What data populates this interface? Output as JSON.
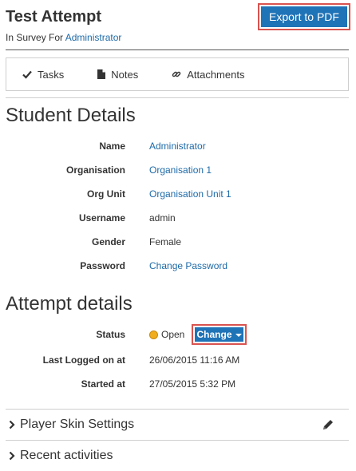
{
  "header": {
    "title": "Test Attempt",
    "subtitle_prefix": "In Survey For",
    "subtitle_link": "Administrator",
    "export_label": "Export to PDF"
  },
  "tabs": [
    {
      "label": "Tasks",
      "icon": "check-icon"
    },
    {
      "label": "Notes",
      "icon": "document-icon"
    },
    {
      "label": "Attachments",
      "icon": "link-icon"
    }
  ],
  "student": {
    "title": "Student Details",
    "rows": [
      {
        "label": "Name",
        "value": "Administrator",
        "is_link": true
      },
      {
        "label": "Organisation",
        "value": "Organisation 1",
        "is_link": true
      },
      {
        "label": "Org Unit",
        "value": "Organisation Unit 1",
        "is_link": true
      },
      {
        "label": "Username",
        "value": "admin",
        "is_link": false
      },
      {
        "label": "Gender",
        "value": "Female",
        "is_link": false
      },
      {
        "label": "Password",
        "value": "Change Password",
        "is_link": true
      }
    ]
  },
  "attempt": {
    "title": "Attempt details",
    "status_label": "Status",
    "status_value": "Open",
    "status_color": "#f0ad1e",
    "change_label": "Change",
    "last_logged_label": "Last Logged on at",
    "last_logged_value": "26/06/2015 11:16 AM",
    "started_label": "Started at",
    "started_value": "27/05/2015 5:32 PM"
  },
  "panels": {
    "player_skin": "Player Skin Settings",
    "recent": "Recent activities"
  },
  "colors": {
    "accent": "#1f73b7",
    "link": "#1e6aa8",
    "highlight": "#d9534f"
  }
}
